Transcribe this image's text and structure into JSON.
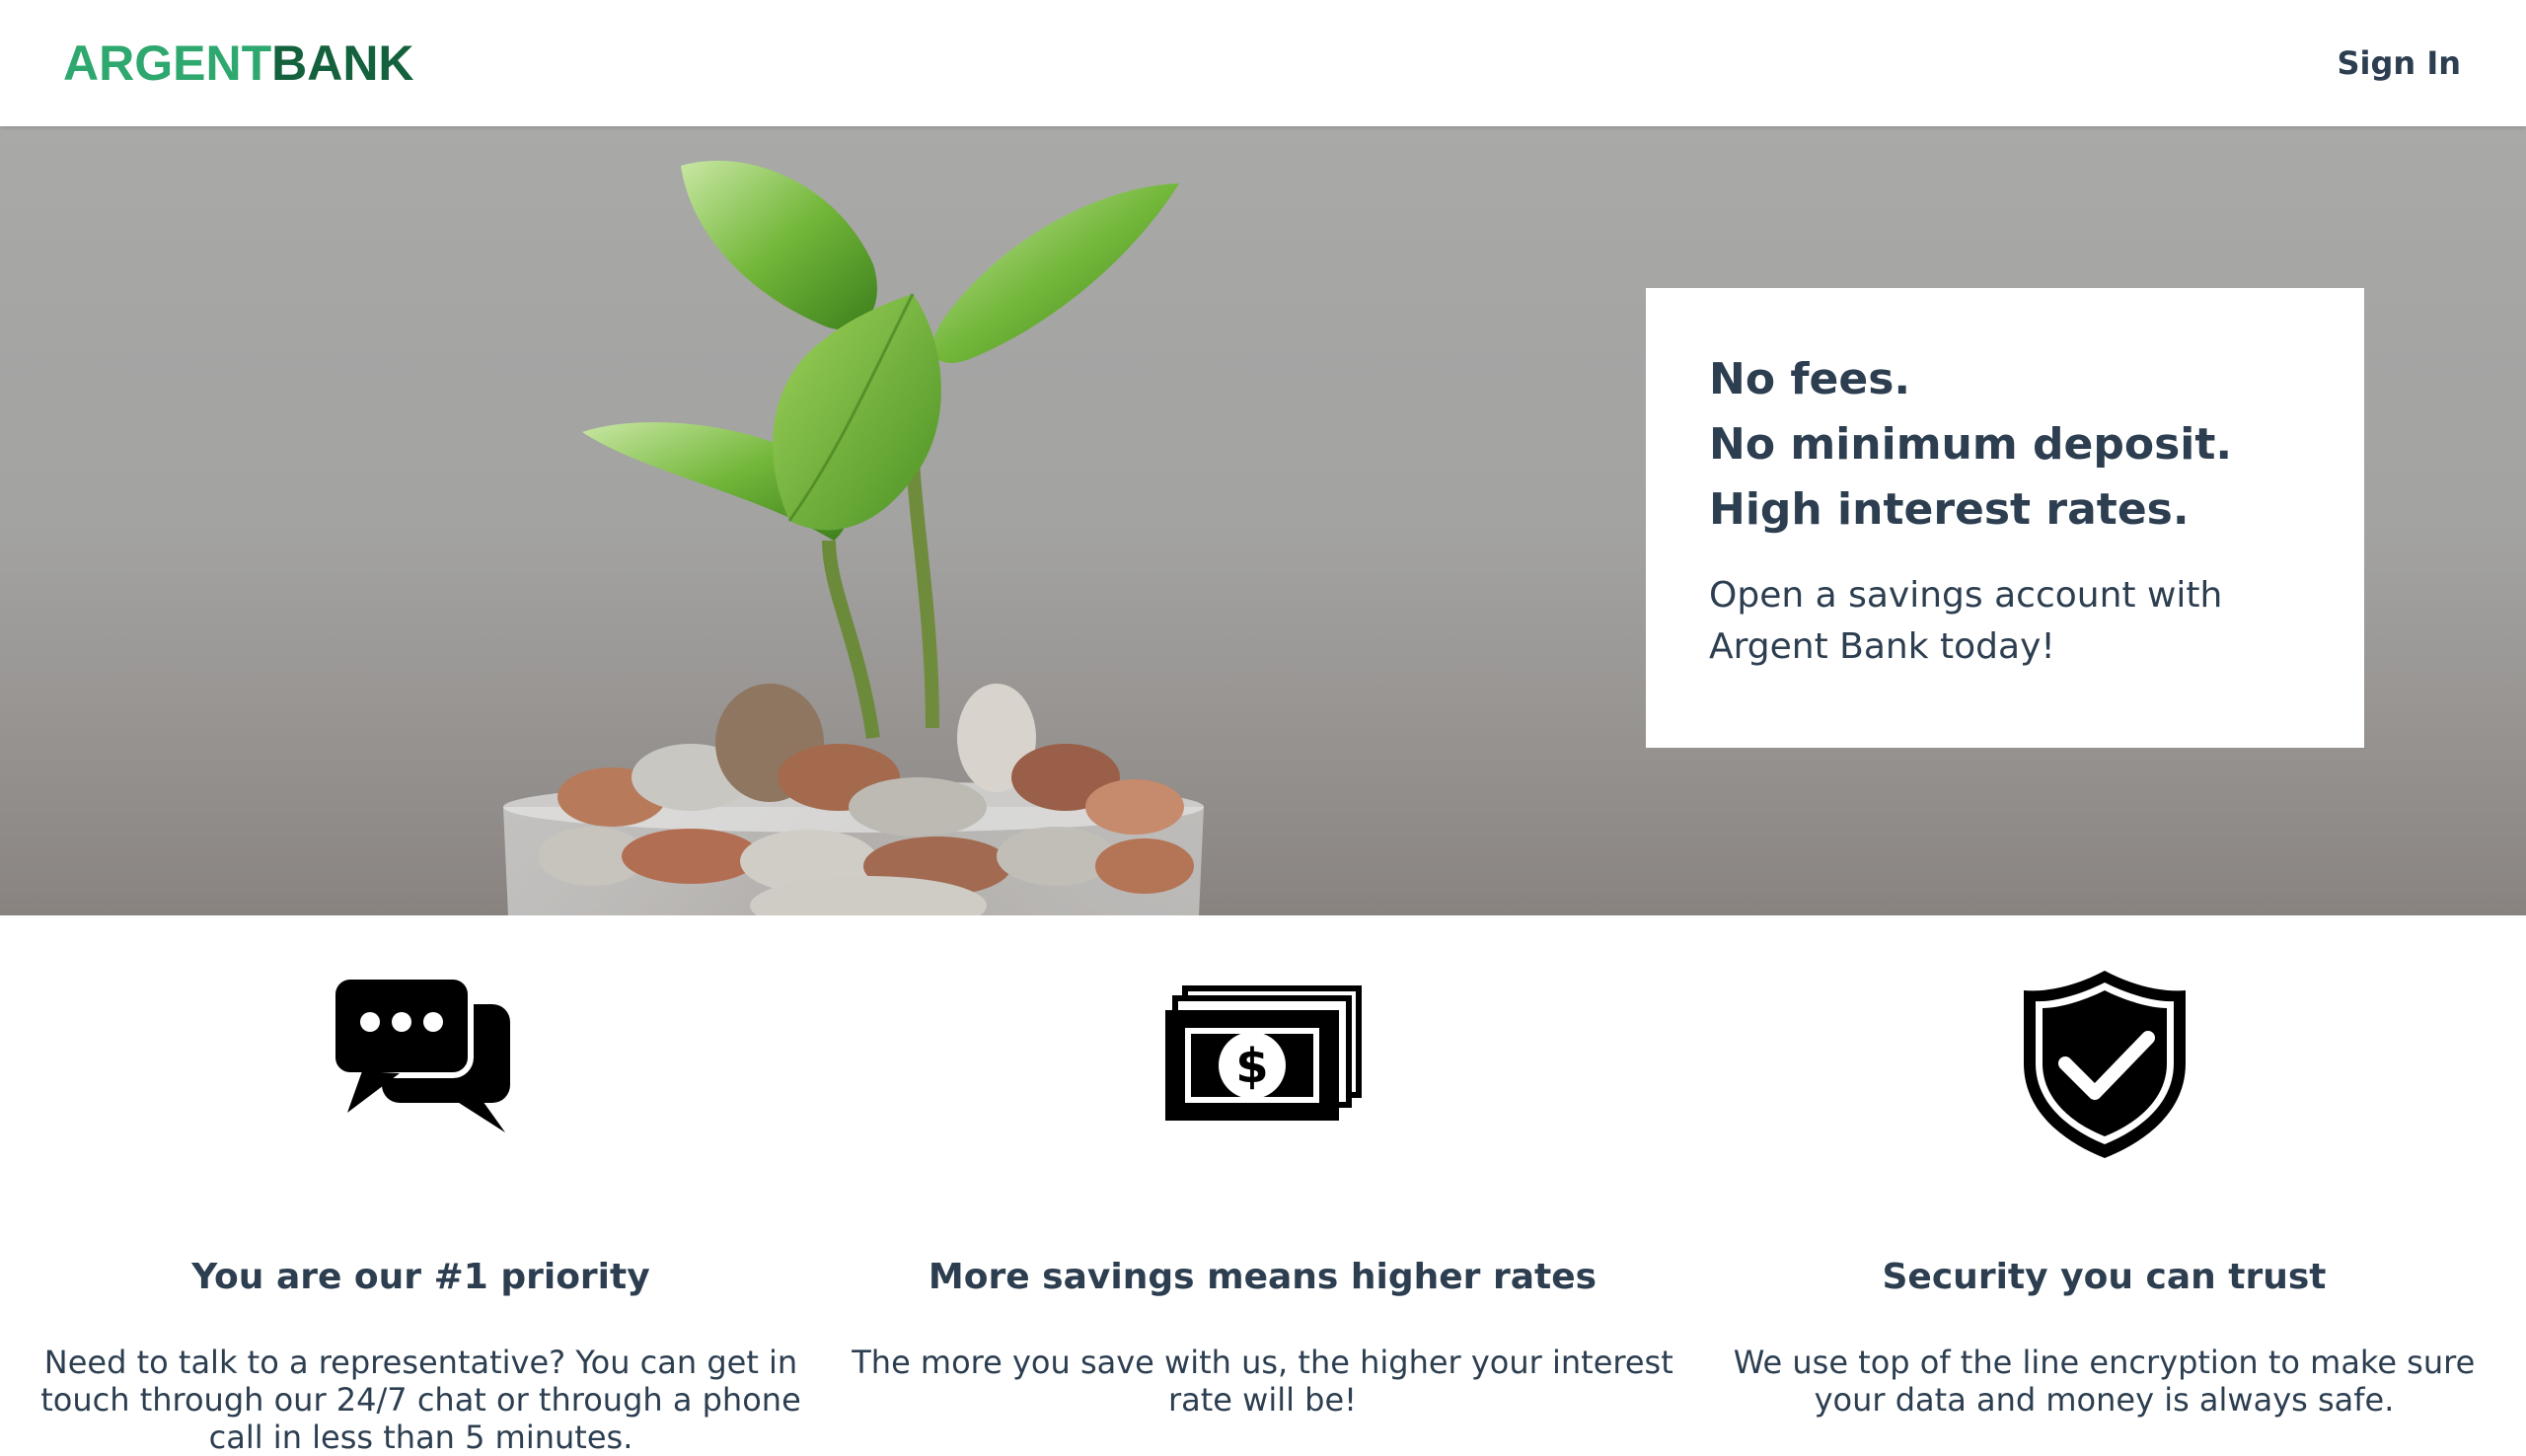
{
  "nav": {
    "logo_part1": "ARGENT",
    "logo_part2": "BANK",
    "sign_in": "Sign In"
  },
  "hero": {
    "headline": [
      "No fees.",
      "No minimum deposit.",
      "High interest rates."
    ],
    "subtext": "Open a savings account with Argent Bank today!"
  },
  "features": [
    {
      "icon": "chat-icon",
      "title": "You are our #1 priority",
      "text": "Need to talk to a representative? You can get in touch through our 24/7 chat or through a phone call in less than 5 minutes."
    },
    {
      "icon": "money-icon",
      "title": "More savings means higher rates",
      "text": "The more you save with us, the higher your interest rate will be!"
    },
    {
      "icon": "shield-icon",
      "title": "Security you can trust",
      "text": "We use top of the line encryption to make sure your data and money is always safe."
    }
  ],
  "colors": {
    "brand_light": "#2ea86e",
    "brand_dark": "#14613e",
    "text": "#2c3e50"
  }
}
